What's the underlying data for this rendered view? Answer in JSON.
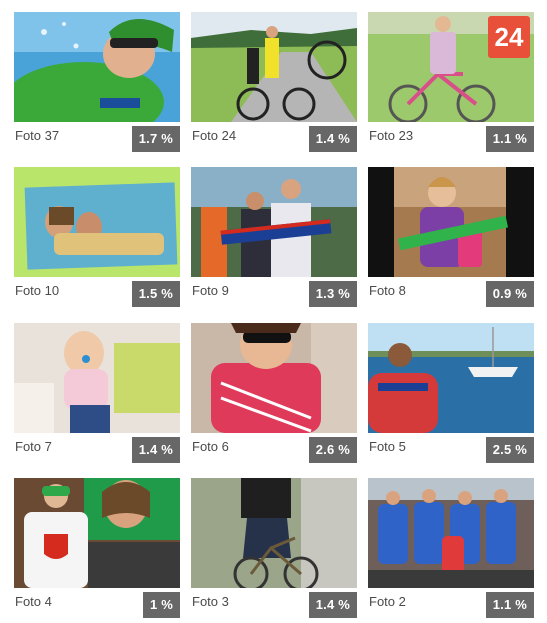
{
  "gallery": {
    "items": [
      {
        "label": "Foto 37",
        "percent": "1.7 %"
      },
      {
        "label": "Foto 24",
        "percent": "1.4 %"
      },
      {
        "label": "Foto 23",
        "percent": "1.1 %",
        "badge": "24"
      },
      {
        "label": "Foto 10",
        "percent": "1.5 %"
      },
      {
        "label": "Foto 9",
        "percent": "1.3 %"
      },
      {
        "label": "Foto 8",
        "percent": "0.9 %"
      },
      {
        "label": "Foto 7",
        "percent": "1.4 %"
      },
      {
        "label": "Foto 6",
        "percent": "2.6 %"
      },
      {
        "label": "Foto 5",
        "percent": "2.5 %"
      },
      {
        "label": "Foto 4",
        "percent": "1 %"
      },
      {
        "label": "Foto 3",
        "percent": "1.4 %"
      },
      {
        "label": "Foto 2",
        "percent": "1.1 %"
      }
    ]
  },
  "colors": {
    "overlay": "#3c3c3c",
    "label_text": "#4a4a4a",
    "badge": "#e8503a"
  },
  "icons": {
    "badge": "tv-channel-24-logo"
  }
}
